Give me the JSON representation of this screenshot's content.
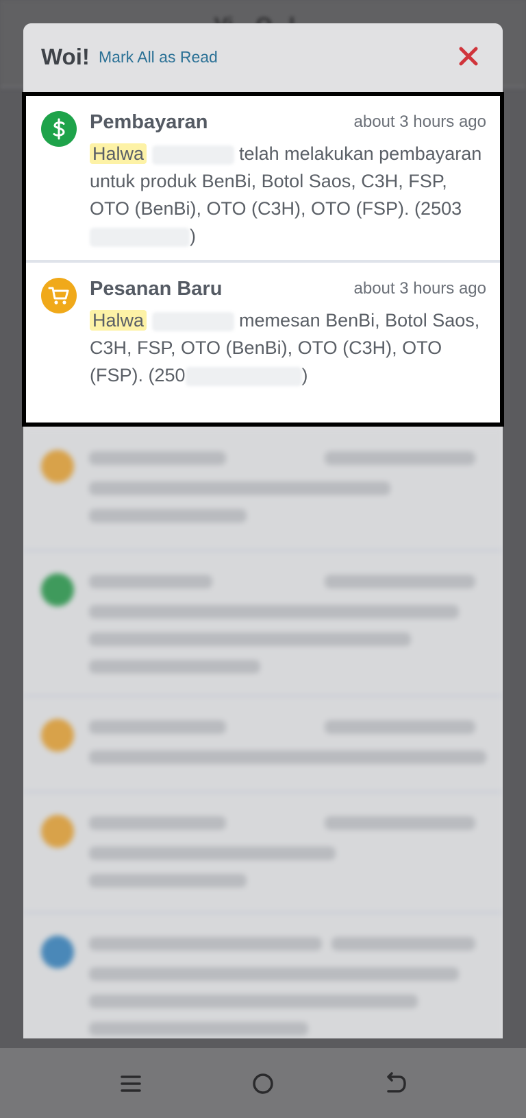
{
  "app": {
    "title": "Vi... O...l..."
  },
  "modal": {
    "title": "Woi!",
    "mark_all_label": "Mark All as Read"
  },
  "notifications": [
    {
      "icon": "dollar-icon",
      "color": "#1ea34a",
      "title": "Pembayaran",
      "time": "about 3 hours ago",
      "name": "Halwa",
      "text_a": " telah melakukan pembayaran untuk produk BenBi, Botol Saos, C3H, FSP, OTO (BenBi), OTO (C3H), OTO (FSP). (2503",
      "text_b": ")"
    },
    {
      "icon": "cart-icon",
      "color": "#f0a91a",
      "title": "Pesanan Baru",
      "time": "about 3 hours ago",
      "name": "Halwa",
      "text_a": " memesan BenBi, Botol Saos, C3H, FSP, OTO (BenBi), OTO (C3H), OTO (FSP). (250",
      "text_b": ")"
    }
  ],
  "colors": {
    "accent_link": "#2b7196",
    "close": "#d0343b",
    "highlight": "#fdf2a6"
  }
}
